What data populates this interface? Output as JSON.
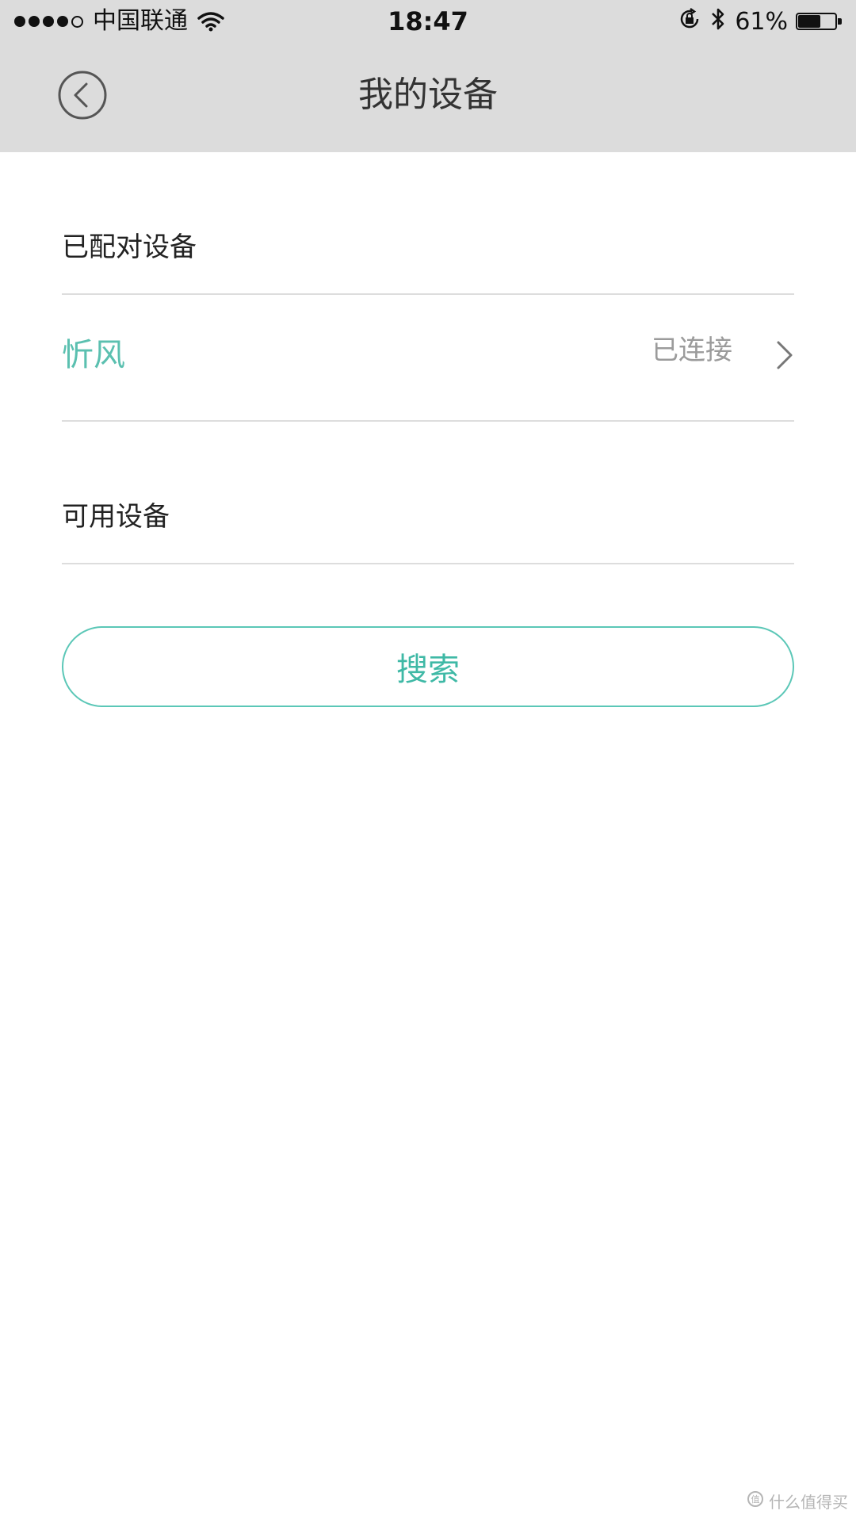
{
  "status_bar": {
    "carrier": "中国联通",
    "time": "18:47",
    "battery_percent_text": "61%",
    "battery_level": 0.61
  },
  "nav": {
    "title": "我的设备"
  },
  "paired_section": {
    "header": "已配对设备",
    "devices": [
      {
        "name": "忻风",
        "status": "已连接"
      }
    ]
  },
  "available_section": {
    "header": "可用设备"
  },
  "search_button": {
    "label": "搜索"
  },
  "watermark": {
    "text": "什么值得买"
  },
  "colors": {
    "accent": "#5bc0b0",
    "nav_bg": "#dcdcdc",
    "status_text": "#9b9b9b"
  }
}
